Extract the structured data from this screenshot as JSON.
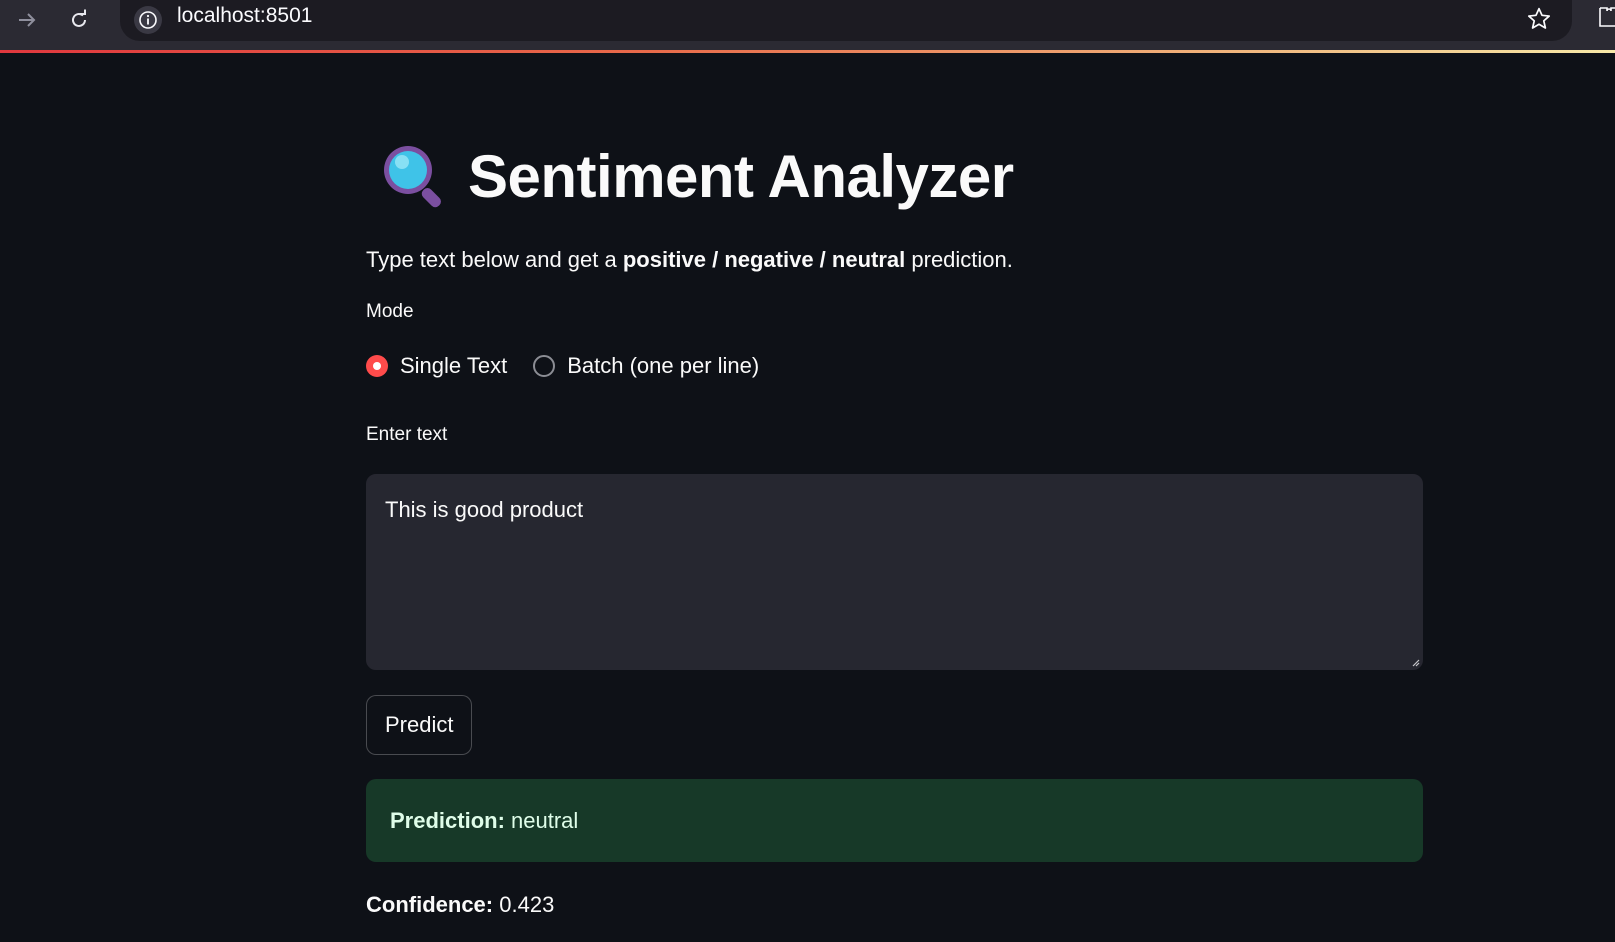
{
  "browser": {
    "url": "localhost:8501"
  },
  "app": {
    "title": "Sentiment Analyzer",
    "title_icon": "magnifying-glass-icon",
    "subtitle_prefix": "Type text below and get a ",
    "subtitle_bold": "positive / negative / neutral",
    "subtitle_suffix": " prediction.",
    "mode": {
      "label": "Mode",
      "options": [
        {
          "label": "Single Text",
          "selected": true
        },
        {
          "label": "Batch (one per line)",
          "selected": false
        }
      ]
    },
    "input": {
      "label": "Enter text",
      "value": "This is good product"
    },
    "predict_label": "Predict",
    "result": {
      "prediction_label": "Prediction:",
      "prediction_value": "neutral",
      "confidence_label": "Confidence:",
      "confidence_value": "0.423"
    }
  },
  "colors": {
    "background": "#0e1117",
    "accent": "#ff4b4b",
    "success_bg": "#173928"
  }
}
